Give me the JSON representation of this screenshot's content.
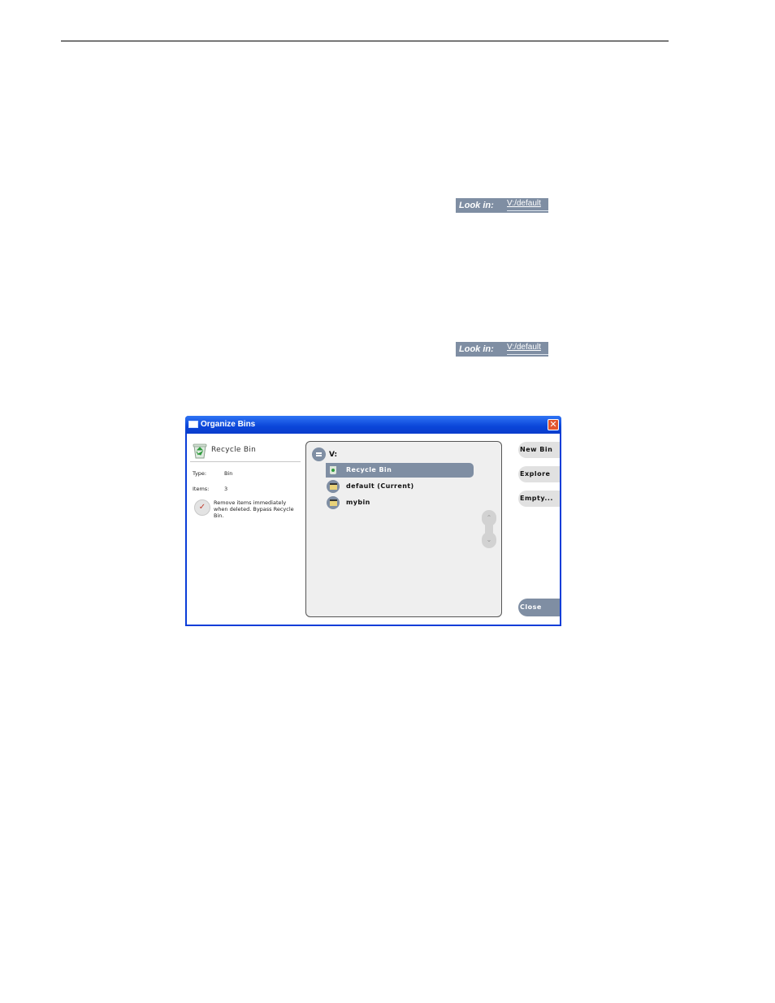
{
  "look_in_bars": [
    {
      "label": "Look in:",
      "path": "V:/default"
    },
    {
      "label": "Look in:",
      "path": "V:/default"
    }
  ],
  "window": {
    "title": "Organize Bins",
    "close_glyph": "✕",
    "left_panel": {
      "heading": "Recycle Bin",
      "icon": "recycle-bin-icon",
      "type_label": "Type:",
      "type_value": "Bin",
      "items_label": "Items:",
      "items_value": "3",
      "checkbox_mark": "✓",
      "checkbox_text": "Remove items immediately when deleted. Bypass Recycle Bin."
    },
    "tree": {
      "drive_label": "V:",
      "items": [
        {
          "label": "Recycle Bin",
          "icon": "recycle-bin-icon",
          "selected": true
        },
        {
          "label": "default (Current)",
          "icon": "bin-clapper-icon",
          "selected": false
        },
        {
          "label": "mybin",
          "icon": "bin-clapper-icon",
          "selected": false
        }
      ],
      "scroll_up": "⌃",
      "scroll_down": "⌄"
    },
    "buttons": {
      "new_bin": "New Bin",
      "explore": "Explore",
      "empty": "Empty...",
      "close": "Close"
    }
  },
  "colors": {
    "accent": "#7f8ea3",
    "window_frame": "#0a3dd8",
    "close_button": "#e2552e"
  }
}
